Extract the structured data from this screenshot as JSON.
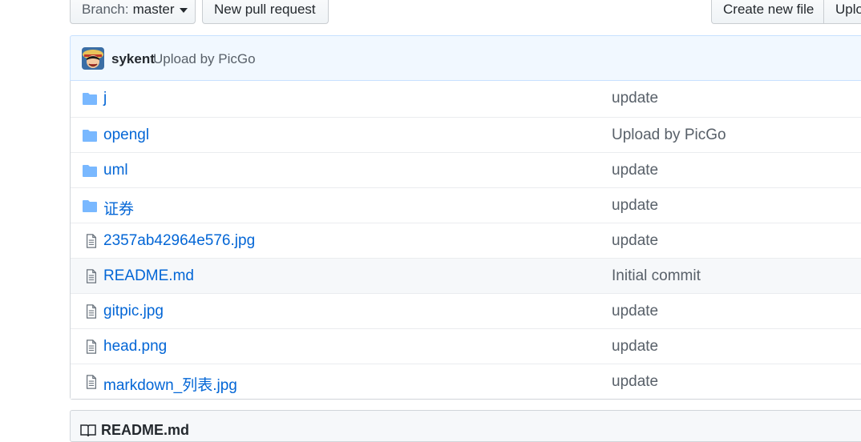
{
  "toolbar": {
    "branch_label": "Branch:",
    "branch_value": "master",
    "new_pull_request": "New pull request",
    "create_new_file": "Create new file",
    "upload_files": "Uplo"
  },
  "commit": {
    "author": "sykent",
    "message": "Upload by PicGo"
  },
  "files": [
    {
      "type": "folder",
      "name": "j",
      "message": "update"
    },
    {
      "type": "folder",
      "name": "opengl",
      "message": "Upload by PicGo"
    },
    {
      "type": "folder",
      "name": "uml",
      "message": "update"
    },
    {
      "type": "folder",
      "name": "证券",
      "message": "update"
    },
    {
      "type": "file",
      "name": "2357ab42964e576.jpg",
      "message": "update"
    },
    {
      "type": "file",
      "name": "README.md",
      "message": "Initial commit"
    },
    {
      "type": "file",
      "name": "gitpic.jpg",
      "message": "update"
    },
    {
      "type": "file",
      "name": "head.png",
      "message": "update"
    },
    {
      "type": "file",
      "name": "markdown_列表.jpg",
      "message": "update"
    }
  ],
  "readme": {
    "title": "README.md"
  },
  "colors": {
    "link": "#0366d6",
    "folder_icon": "#79b8ff",
    "commit_bar_bg": "#f1f8ff"
  }
}
